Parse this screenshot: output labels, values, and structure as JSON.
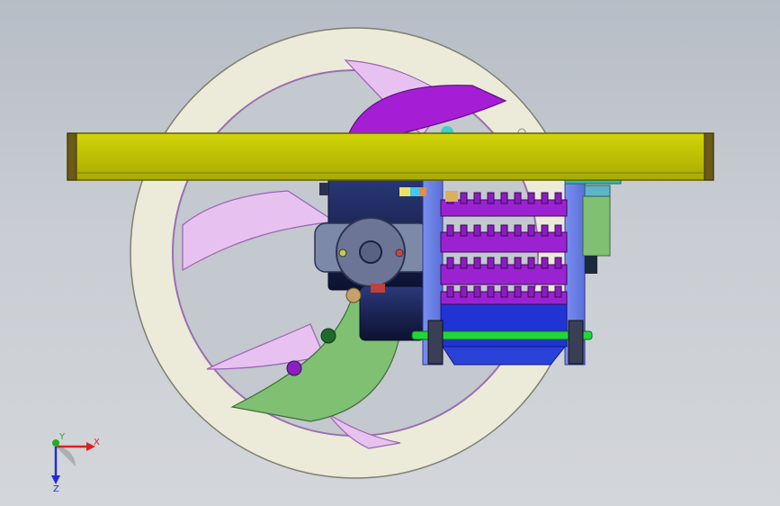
{
  "view": {
    "background_top": "#b7bdc6",
    "background_bottom": "#d3d6da"
  },
  "model": {
    "wheel_color": "#ecebda",
    "blade_color": "#e8c4f0",
    "top_beam_color": "#c5c700",
    "purple_sector_color": "#a51ed6",
    "green_sector_color": "#7fc073",
    "gear_purple": "#9b22d0",
    "motor_gray": "#6b738f",
    "frame_blue": "#6a7fe6",
    "shaft_green": "#22d63a"
  },
  "triad": {
    "x_label": "X",
    "y_label": "Y",
    "z_label": "Z",
    "x_color": "#e02020",
    "y_color": "#20b020",
    "z_color": "#2030d0"
  }
}
